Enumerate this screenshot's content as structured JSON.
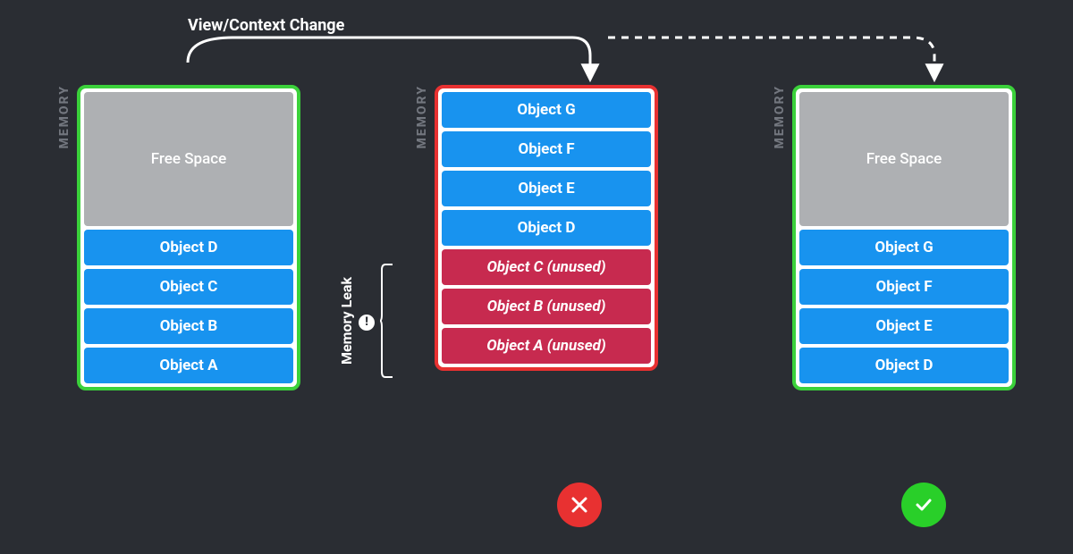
{
  "arrow_label": "View/Context Change",
  "memory_label": "MEMORY",
  "memory_leak_label": "Memory Leak",
  "leak_icon_char": "!",
  "columns": {
    "before": {
      "border": "green",
      "free_label": "Free Space",
      "objects": [
        "Object D",
        "Object C",
        "Object B",
        "Object A"
      ]
    },
    "leak": {
      "border": "red",
      "objects": [
        "Object G",
        "Object F",
        "Object E",
        "Object D"
      ],
      "leaked": [
        "Object C (unused)",
        "Object B (unused)",
        "Object A (unused)"
      ]
    },
    "after": {
      "border": "green",
      "free_label": "Free Space",
      "objects": [
        "Object G",
        "Object F",
        "Object E",
        "Object D"
      ]
    }
  },
  "colors": {
    "bg": "#2a2d33",
    "object": "#1893ef",
    "leak": "#c72a4f",
    "free": "#aeb0b3",
    "good_border": "#3bd13b",
    "bad_border": "#e83131"
  }
}
